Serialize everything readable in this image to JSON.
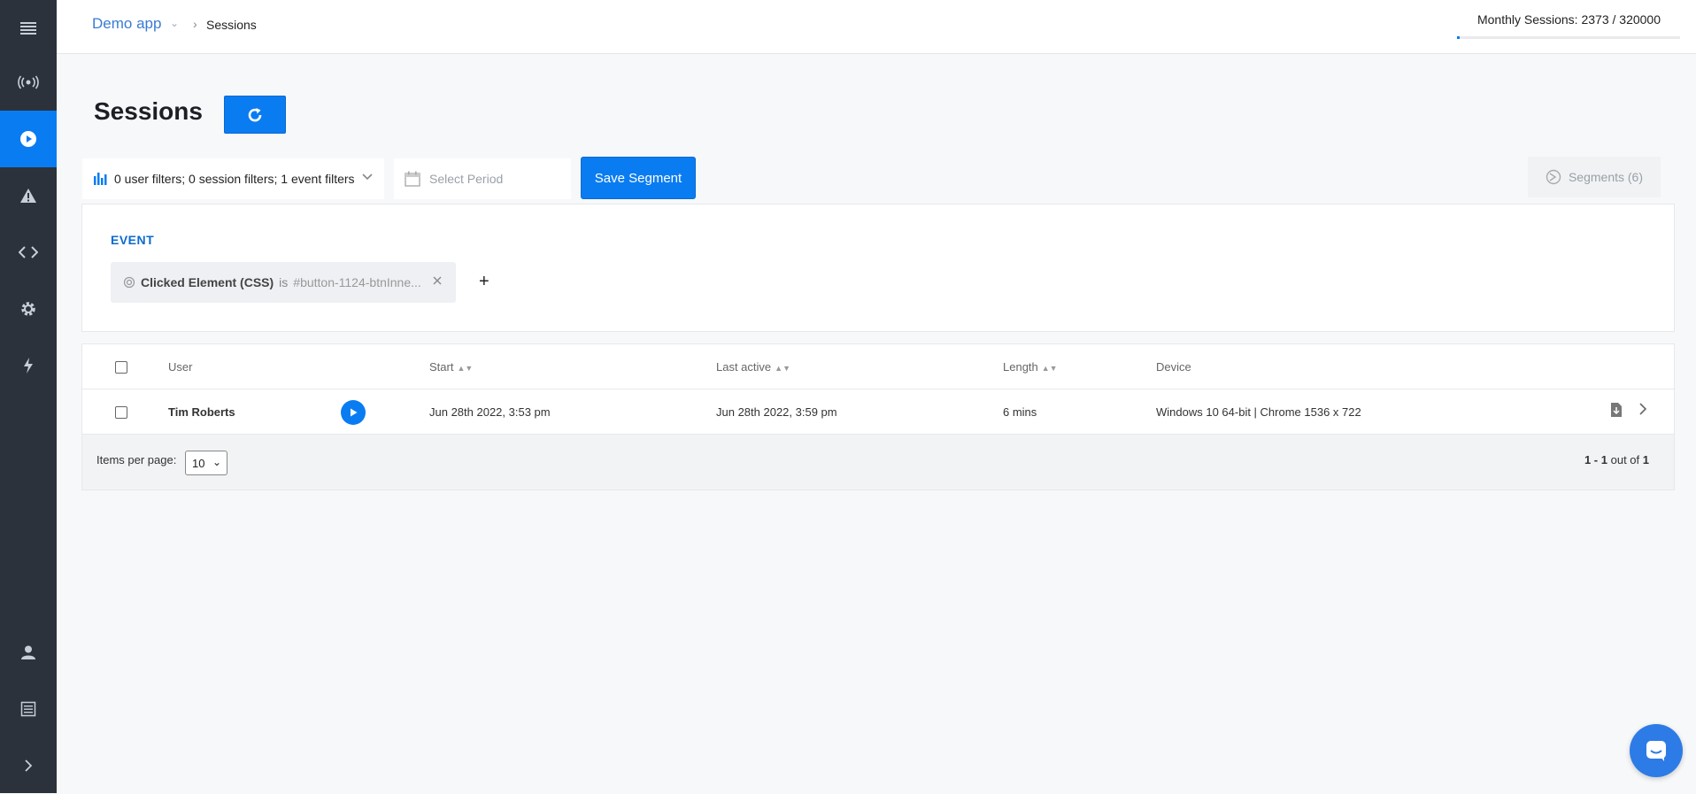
{
  "topbar": {
    "app_name": "Demo app",
    "breadcrumb": "Sessions",
    "monthly_sessions": "Monthly Sessions: 2373 / 320000",
    "monthly_sessions_progress": 0.0074
  },
  "page": {
    "title": "Sessions"
  },
  "filters": {
    "summary": "0 user filters; 0 session filters; 1 event filters",
    "period_placeholder": "Select Period",
    "save_segment_label": "Save Segment",
    "segments_label": "Segments (6)"
  },
  "event_panel": {
    "label": "EVENT",
    "chip": {
      "property": "Clicked Element (CSS)",
      "operator": "is",
      "value": "#button-1124-btnInne..."
    },
    "add_label": "+"
  },
  "table": {
    "columns": [
      "User",
      "Start",
      "Last active",
      "Length",
      "Device"
    ],
    "rows": [
      {
        "user": "Tim Roberts",
        "start": "Jun 28th 2022, 3:53 pm",
        "last_active": "Jun 28th 2022, 3:59 pm",
        "length": "6 mins",
        "device": "Windows 10 64-bit | Chrome 1536 x 722"
      }
    ],
    "items_per_page_label": "Items per page:",
    "items_per_page_value": "10",
    "pagination": {
      "range": "1 - 1",
      "out_of_label": "out of",
      "total": "1"
    }
  },
  "icons": {
    "sidebar": [
      "menu-icon",
      "broadcast-icon",
      "play-circle-icon",
      "warning-icon",
      "code-icon",
      "gear-icon",
      "bolt-icon",
      "user-icon",
      "list-icon",
      "chevron-right-icon"
    ]
  }
}
